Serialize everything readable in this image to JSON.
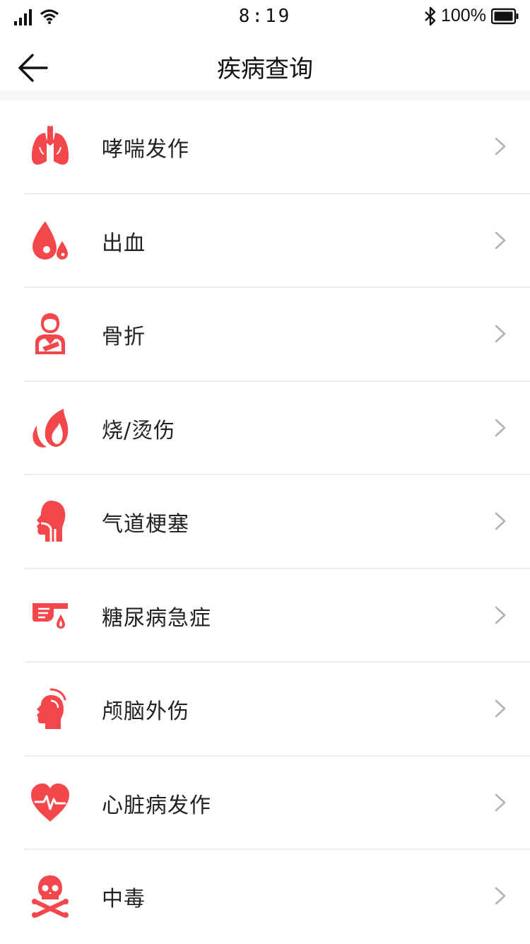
{
  "status_bar": {
    "time": "8:19",
    "battery": "100%",
    "signal_icon": "signal-icon",
    "wifi_icon": "wifi-icon",
    "bluetooth_icon": "bluetooth-icon",
    "battery_icon": "battery-icon"
  },
  "header": {
    "title": "疾病查询",
    "back_icon": "back-arrow-icon"
  },
  "colors": {
    "accent": "#f4474b",
    "chevron": "#b3b3b3",
    "divider": "#ececec"
  },
  "items": [
    {
      "label": "哮喘发作",
      "icon": "lungs-icon"
    },
    {
      "label": "出血",
      "icon": "blood-drop-icon"
    },
    {
      "label": "骨折",
      "icon": "arm-sling-icon"
    },
    {
      "label": "烧/烫伤",
      "icon": "flame-icon"
    },
    {
      "label": "气道梗塞",
      "icon": "throat-icon"
    },
    {
      "label": "糖尿病急症",
      "icon": "finger-prick-icon"
    },
    {
      "label": "颅脑外伤",
      "icon": "head-injury-icon"
    },
    {
      "label": "心脏病发作",
      "icon": "heart-pulse-icon"
    },
    {
      "label": "中毒",
      "icon": "skull-crossbones-icon"
    }
  ]
}
